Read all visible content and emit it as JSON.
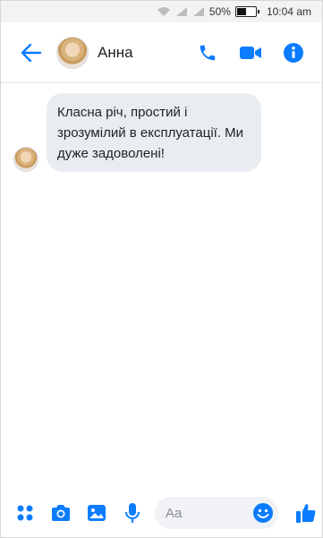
{
  "status_bar": {
    "battery_percent": "50%",
    "battery_level": 0.5,
    "time": "10:04 am"
  },
  "header": {
    "contact_name": "Анна",
    "icons": [
      "back-arrow-icon",
      "phone-icon",
      "video-camera-icon",
      "info-icon"
    ]
  },
  "thread": {
    "messages": [
      {
        "sender": "Анна",
        "text": "Класна річ, простий і зрозумілий в експлуатації. Ми дуже задоволені!"
      }
    ]
  },
  "composer": {
    "placeholder": "Aa",
    "icons": [
      "apps-icon",
      "camera-icon",
      "image-icon",
      "microphone-icon",
      "emoji-icon",
      "thumbs-up-icon"
    ]
  },
  "colors": {
    "accent": "#0a7cff",
    "bubble": "#e9edf2",
    "status_bar_bg": "#f3f3f3"
  }
}
